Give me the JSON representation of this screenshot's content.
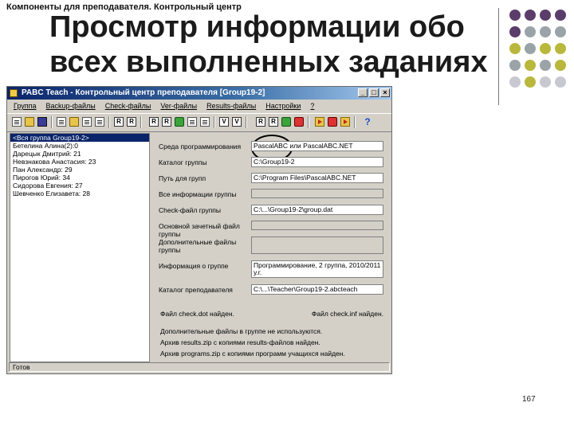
{
  "slide": {
    "header": "Компоненты для преподавателя. Контрольный центр",
    "title": "Просмотр информации обо всех выполненных заданиях",
    "page_number": "167",
    "dot_colors": [
      "#5b3d6b",
      "#9aa3a8",
      "#b9b83c",
      "#c8c8d0"
    ]
  },
  "window": {
    "title": "PABC Teach - Контрольный центр преподавателя [Group19-2]",
    "menu": [
      "Группа",
      "Backup-файлы",
      "Check-файлы",
      "Ver-файлы",
      "Results-файлы",
      "Настройки",
      "?"
    ],
    "toolbar_letters": [
      "R",
      "R",
      "R",
      "R",
      "V",
      "V",
      "R",
      "R",
      "R",
      "R"
    ],
    "students": [
      "<Вся группа Group19-2>",
      "Бетелина Алина(2):0",
      "Дарецык Дмитрий: 21",
      "Невзнакова Анастасия: 23",
      "Пан Александр: 29",
      "Пирогов Юрий: 34",
      "Сидорова Евгения: 27",
      "Шевченко Елизавета: 28"
    ],
    "info": {
      "env_label": "Среда программирования",
      "env_value": "PascalABC или PascalABC.NET",
      "dir_label": "Каталог группы",
      "dir_value": "C:\\Group19-2",
      "tasks_label": "Путь для групп",
      "tasks_value": "C:\\Program Files\\PascalABC.NET",
      "group_label": "Все информации группы",
      "check_label": "Check-файл группы",
      "check_value": "C:\\...\\Group19-2\\group.dat",
      "main_label": "Основной зачетный файл группы",
      "extra_label": "Дополнительные файлы группы",
      "about_label": "Информация о группе",
      "about_value": "Программирование, 2 группа, 2010/2011 у.г.",
      "teacher_label": "Каталог преподавателя",
      "teacher_value": "C:\\...\\Teacher\\Group19-2.abcteach",
      "dotnet_left": "Файл check.dot найден.",
      "dotnet_right": "Файл check.inf найден.",
      "note1": "Дополнительные файлы в группе не используются.",
      "note2": "Архив results.zip с копиями results-файлов найден.",
      "note3": "Архив programs.zip с копиями программ учащихся найден."
    },
    "status": "Готов"
  }
}
